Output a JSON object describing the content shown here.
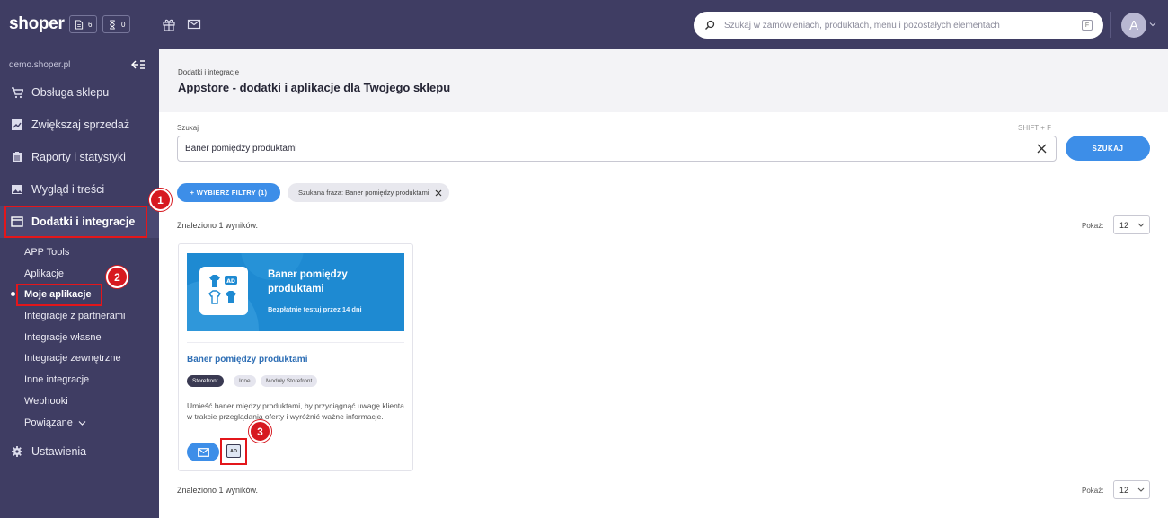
{
  "topbar": {
    "logo": "shoper",
    "badge_orders_count": "6",
    "badge_pending_count": "0",
    "search_placeholder": "Szukaj w zamówieniach, produktach, menu i pozostałych elementach",
    "search_shortcut": "F",
    "avatar_initial": "A"
  },
  "sidebar": {
    "store": "demo.shoper.pl",
    "items": [
      {
        "label": "Obsługa sklepu",
        "icon": "cart-icon"
      },
      {
        "label": "Zwiększaj sprzedaż",
        "icon": "chart-icon"
      },
      {
        "label": "Raporty i statystyki",
        "icon": "clipboard-icon"
      },
      {
        "label": "Wygląd i treści",
        "icon": "image-icon"
      },
      {
        "label": "Dodatki i integracje",
        "icon": "window-icon"
      }
    ],
    "subitems": [
      "APP Tools",
      "Aplikacje",
      "Moje aplikacje",
      "Integracje z partnerami",
      "Integracje własne",
      "Integracje zewnętrzne",
      "Inne integracje",
      "Webhooki",
      "Powiązane"
    ],
    "settings": "Ustawienia"
  },
  "header": {
    "breadcrumb": "Dodatki i integracje",
    "title": "Appstore - dodatki i aplikacje dla Twojego sklepu"
  },
  "search": {
    "label": "Szukaj",
    "shortcut": "SHIFT + F",
    "value": "Baner pomiędzy produktami",
    "button": "SZUKAJ"
  },
  "filters": {
    "button": "+ WYBIERZ FILTRY (1)",
    "chip": "Szukana fraza: Baner pomiędzy produktami"
  },
  "results": {
    "found_text": "Znaleziono 1 wyników.",
    "show_label": "Pokaż:",
    "per_page": "12"
  },
  "card": {
    "banner_title": "Baner pomiędzy produktami",
    "banner_subtitle": "Bezpłatnie testuj przez 14 dni",
    "title": "Baner pomiędzy produktami",
    "tags": [
      "Storefront",
      "Inne",
      "Moduły Storefront"
    ],
    "description": "Umieść baner między produktami, by przyciągnąć uwagę klienta w trakcie przeglądania oferty i wyróżnić ważne informacje.",
    "ad_label": "AD"
  },
  "annotations": [
    "1",
    "2",
    "3"
  ],
  "colors": {
    "sidebar": "#3f3d63",
    "accent": "#3d8ee8",
    "highlight": "#e3161b"
  }
}
